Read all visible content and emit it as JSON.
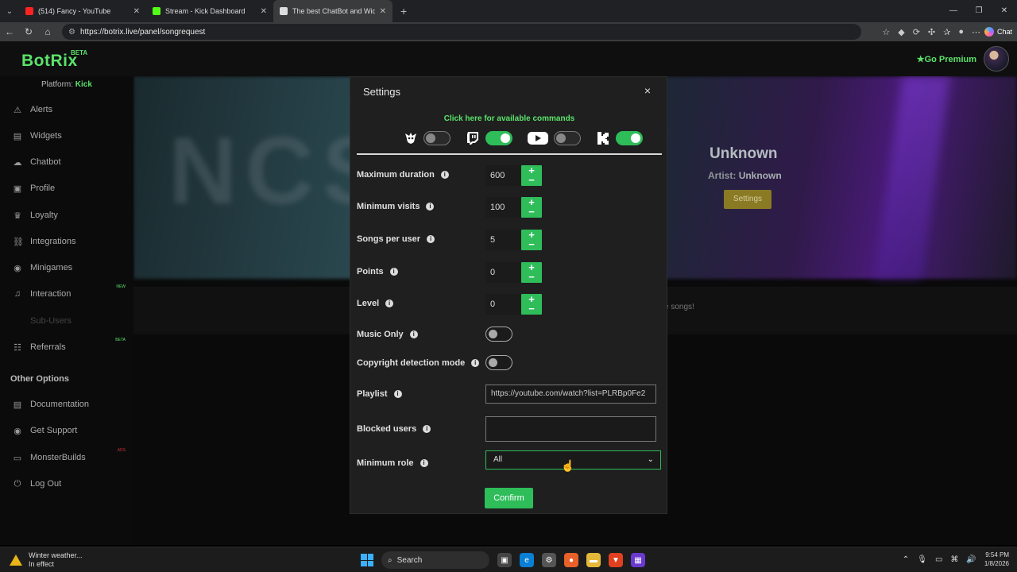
{
  "browser": {
    "tabs": [
      {
        "title": "(514) Fancy - YouTube",
        "fav_color": "#ff2222"
      },
      {
        "title": "Stream - Kick Dashboard",
        "fav_color": "#53fc18"
      },
      {
        "title": "The best ChatBot and Widgets for",
        "fav_color": "#dddddd"
      }
    ],
    "url": "https://botrix.live/panel/songrequest",
    "chat_label": "Chat"
  },
  "app": {
    "brand": "BotRix",
    "beta": "BETA",
    "premium": "Go Premium",
    "platform_label": "Platform:",
    "platform_value": "Kick"
  },
  "sidebar": {
    "items": [
      {
        "label": "Alerts",
        "icon": "⚠"
      },
      {
        "label": "Widgets",
        "icon": "▤"
      },
      {
        "label": "Chatbot",
        "icon": "☁"
      },
      {
        "label": "Profile",
        "icon": "▣"
      },
      {
        "label": "Loyalty",
        "icon": "🏆"
      },
      {
        "label": "Integrations",
        "icon": "⛓"
      },
      {
        "label": "Minigames",
        "icon": "◉"
      },
      {
        "label": "Interaction",
        "icon": "♫",
        "tag": "NEW"
      },
      {
        "label": "Sub-Users",
        "icon": ""
      },
      {
        "label": "Referrals",
        "icon": "👥",
        "tag": "BETA"
      }
    ],
    "other_heading": "Other Options",
    "other_items": [
      {
        "label": "Documentation",
        "icon": "▤"
      },
      {
        "label": "Get Support",
        "icon": "◉"
      },
      {
        "label": "MonsterBuilds",
        "icon": "▭",
        "tag": "ADS"
      },
      {
        "label": "Log Out",
        "icon": "⏻"
      }
    ]
  },
  "background": {
    "song_title": "Unknown",
    "artist_label": "Artist:",
    "artist_value": "Unknown",
    "settings_button": "Settings",
    "hint": "e songs!"
  },
  "modal": {
    "title": "Settings",
    "close": "×",
    "commands_link": "Click here for available commands",
    "platforms": [
      {
        "name": "botrix",
        "on": false
      },
      {
        "name": "twitch",
        "on": true
      },
      {
        "name": "youtube",
        "on": false
      },
      {
        "name": "kick",
        "on": true
      }
    ],
    "fields": {
      "max_duration": {
        "label": "Maximum duration",
        "value": "600"
      },
      "min_visits": {
        "label": "Minimum visits",
        "value": "100"
      },
      "songs_per_user": {
        "label": "Songs per user",
        "value": "5"
      },
      "points": {
        "label": "Points",
        "value": "0"
      },
      "level": {
        "label": "Level",
        "value": "0"
      },
      "music_only": {
        "label": "Music Only"
      },
      "copyright": {
        "label": "Copyright detection mode"
      },
      "playlist": {
        "label": "Playlist",
        "value": "https://youtube.com/watch?list=PLRBp0Fe2"
      },
      "blocked": {
        "label": "Blocked users",
        "value": ""
      },
      "min_role": {
        "label": "Minimum role",
        "value": "All"
      }
    },
    "confirm": "Confirm"
  },
  "taskbar": {
    "weather_title": "Winter weather...",
    "weather_sub": "In effect",
    "search": "Search",
    "time": "9:54 PM",
    "date": "1/8/2026"
  }
}
